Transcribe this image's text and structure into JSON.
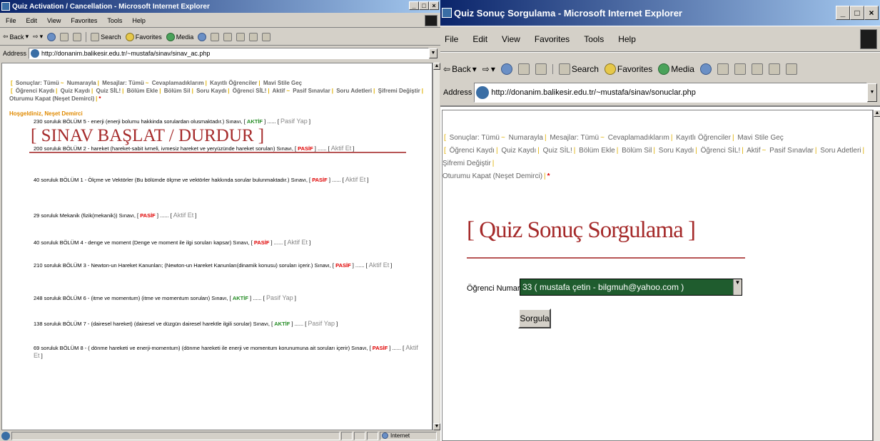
{
  "left_window": {
    "title": "Quiz Activation / Cancellation - Microsoft Internet Explorer",
    "menu": [
      "File",
      "Edit",
      "View",
      "Favorites",
      "Tools",
      "Help"
    ],
    "toolbar": {
      "back": "Back",
      "search": "Search",
      "favorites": "Favorites",
      "media": "Media"
    },
    "address_label": "Address",
    "url": "http://donanim.balikesir.edu.tr/~mustafa/sinav/sinav_ac.php",
    "status_zone": "Internet"
  },
  "right_window": {
    "title": "Quiz Sonuç Sorgulama - Microsoft Internet Explorer",
    "menu": [
      "File",
      "Edit",
      "View",
      "Favorites",
      "Tools",
      "Help"
    ],
    "toolbar": {
      "back": "Back",
      "search": "Search",
      "favorites": "Favorites",
      "media": "Media"
    },
    "address_label": "Address",
    "url": "http://donanim.balikesir.edu.tr/~mustafa/sinav/sonuclar.php"
  },
  "nav": {
    "row1": [
      "Sonuçlar: Tümü",
      "Numarayla",
      "Mesajlar: Tümü",
      "Cevaplamadıklarım",
      "Kayıtlı Öğrenciler",
      "Mavi Stile Geç"
    ],
    "row2": [
      "Öğrenci Kaydı",
      "Quiz Kaydı",
      "Quiz SİL!",
      "Bölüm Ekle",
      "Bölüm Sil",
      "Soru Kaydı",
      "Öğrenci SİL!",
      "Aktif",
      "Pasif Sınavlar",
      "Soru Adetleri",
      "Şifremi Değiştir"
    ],
    "row3": "Oturumu Kapat (Neşet Demirci)",
    "star": "*"
  },
  "welcome": "Hoşgeldiniz, Neşet Demirci",
  "left_heading": "[ SINAV BAŞLAT / DURDUR ]",
  "exams": [
    {
      "prefix": "230 soruluk BÖLÜM 5 - enerji (enerji bolumu hakkinda sorulardan olusmaktadır.) Sınavı, [",
      "state": "AKTİF",
      "active": true,
      "mid": "] ...... [",
      "action": "Pasif Yap",
      "suffix": "]"
    },
    {
      "prefix": "200 soruluk BÖLÜM 2 - hareket (hareket-sabit ivmeli, ivmesiz hareket ve yeryüzünde hareket soruları) Sınavı, [",
      "state": "PASİF",
      "active": false,
      "mid": "] ...... [",
      "action": "Aktif Et",
      "suffix": "]"
    },
    {
      "prefix": "40 soruluk BÖLÜM 1 - Ölçme ve Vektörler (Bu bölümde ölçme ve vektörler hakkında sorular bulunmaktadır.) Sınavı, [",
      "state": "PASİF",
      "active": false,
      "mid": "] ...... [",
      "action": "Aktif Et",
      "suffix": "]"
    },
    {
      "prefix": "29 soruluk Mekanik (fizik(mekanik)) Sınavı, [",
      "state": "PASİF",
      "active": false,
      "mid": "] ...... [",
      "action": "Aktif Et",
      "suffix": "]"
    },
    {
      "prefix": "40 soruluk BÖLÜM 4 - denge ve moment (Denge ve moment ile ilgi soruları kapsar) Sınavı, [",
      "state": "PASİF",
      "active": false,
      "mid": "] ...... [",
      "action": "Aktif Et",
      "suffix": "]"
    },
    {
      "prefix": "210 soruluk BÖLÜM 3 - Newton-un Hareket Kanunları; (Newton-un Hareket Kanunları(dinamik konusu) soruları içerir.) Sınavı, [",
      "state": "PASİF",
      "active": false,
      "mid": "] ...... [",
      "action": "Aktif Et",
      "suffix": "]"
    },
    {
      "prefix": "248 soruluk BÖLÜM 6 - (itme ve momentum) (itme ve momentum soruları) Sınavı, [",
      "state": "AKTİF",
      "active": true,
      "mid": "] ...... [",
      "action": "Pasif Yap",
      "suffix": "]"
    },
    {
      "prefix": "138 soruluk BÖLÜM 7 - (dairesel hareket) (dairesel ve düzgün dairesel harektle ilgili sorular) Sınavı, [",
      "state": "AKTİF",
      "active": true,
      "mid": "] ...... [",
      "action": "Pasif Yap",
      "suffix": "]"
    },
    {
      "prefix": "69 soruluk BÖLÜM 8 - ( dönme hareketi ve enerji-momentum) (dönme hareketi ile enerji ve momentum korunumuna ait soruları içerir) Sınavı, [",
      "state": "PASİF",
      "active": false,
      "mid": "] ...... [",
      "action": "Aktif Et",
      "suffix": "]"
    }
  ],
  "right_heading": "[ Quiz Sonuç Sorgulama ]",
  "form": {
    "label": "Öğrenci Numarası",
    "selected": "33 ( mustafa çetin - bilgmuh@yahoo.com )",
    "submit": "Sorgula"
  }
}
